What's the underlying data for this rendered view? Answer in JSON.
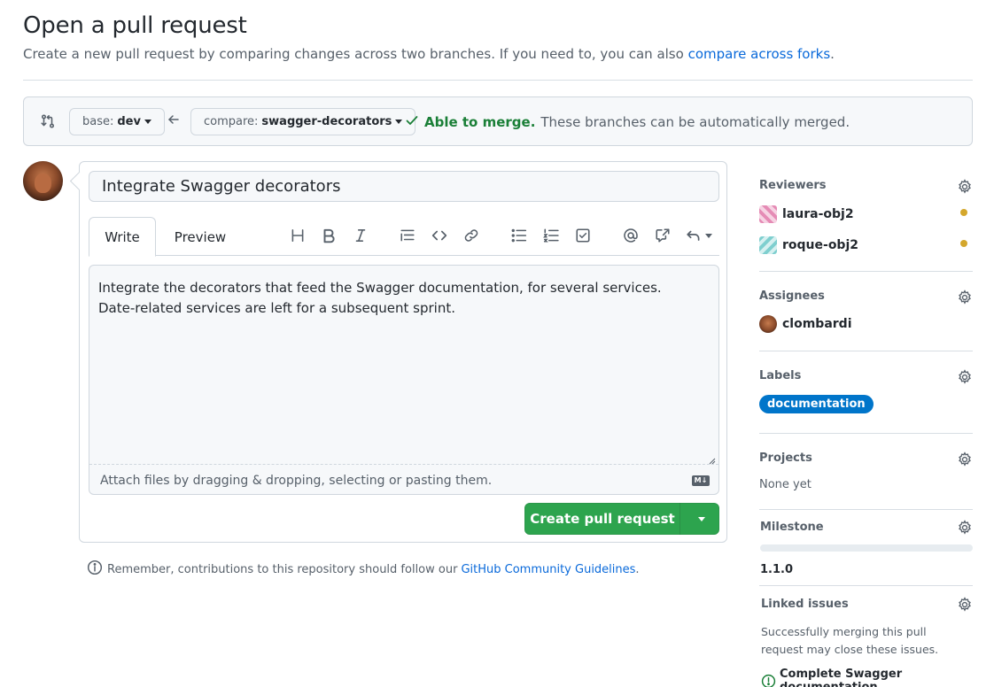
{
  "header": {
    "title": "Open a pull request",
    "subtitle": "Create a new pull request by comparing changes across two branches. If you need to, you can also",
    "subtitle_link": "compare across forks",
    "subtitle_end": "."
  },
  "range": {
    "base_prefix": "base:",
    "base_branch": "dev",
    "compare_prefix": "compare:",
    "compare_branch": "swagger-decorators",
    "merge_ok": "Able to merge.",
    "merge_text": "These branches can be automatically merged."
  },
  "composer": {
    "title_value": "Integrate Swagger decorators",
    "tabs": {
      "write": "Write",
      "preview": "Preview"
    },
    "body_value": "Integrate the decorators that feed the Swagger documentation, for several services.\nDate-related services are left for a subsequent sprint.",
    "attach_hint": "Attach files by dragging & dropping, selecting or pasting them.",
    "markdown_badge": "M↓",
    "submit_label": "Create pull request"
  },
  "footnote": {
    "text": "Remember, contributions to this repository should follow our",
    "link": "GitHub Community Guidelines",
    "end": "."
  },
  "sidebar": {
    "reviewers": {
      "heading": "Reviewers",
      "items": [
        {
          "name": "laura-obj2",
          "identicon_color": "#e58bb5",
          "status_color": "#d4a72c"
        },
        {
          "name": "roque-obj2",
          "identicon_color": "#7fcfcf",
          "status_color": "#d4a72c"
        }
      ]
    },
    "assignees": {
      "heading": "Assignees",
      "items": [
        {
          "name": "clombardi"
        }
      ]
    },
    "labels": {
      "heading": "Labels",
      "items": [
        {
          "name": "documentation",
          "color": "#0075ca"
        }
      ]
    },
    "projects": {
      "heading": "Projects",
      "value": "None yet"
    },
    "milestone": {
      "heading": "Milestone",
      "value": "1.1.0",
      "progress": 0
    },
    "linked_issues": {
      "heading": "Linked issues",
      "description": "Successfully merging this pull request may close these issues.",
      "issue": "Complete Swagger documentation"
    }
  },
  "colors": {
    "accent_green": "#2da44e",
    "link_blue": "#0969da",
    "label_blue": "#0075ca",
    "pending_dot": "#d4a72c"
  }
}
